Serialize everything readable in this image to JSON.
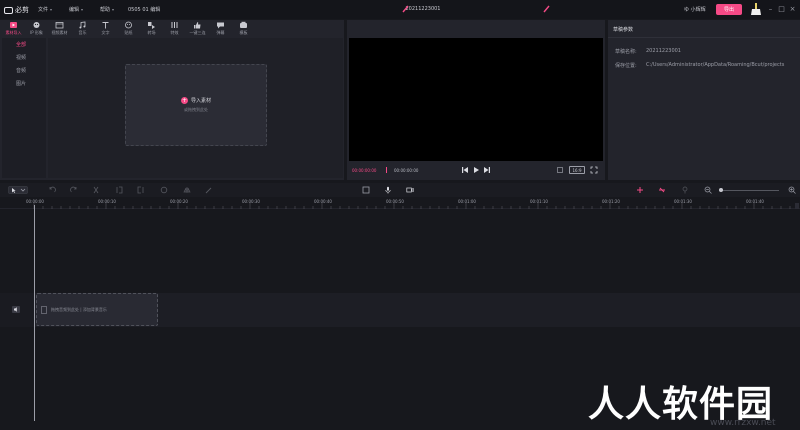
{
  "titlebar": {
    "app_name": "必剪",
    "menus": [
      "文件",
      "编辑",
      "帮助"
    ],
    "project_name": "0505 01 编辑",
    "center_title": "20211223001",
    "user_name": "ゆ 小辉辉",
    "export_label": "导出"
  },
  "tools": [
    {
      "label": "素材导入",
      "icon": "media-icon",
      "active": true
    },
    {
      "label": "IP 形象",
      "icon": "avatar-icon",
      "active": false
    },
    {
      "label": "视频素材",
      "icon": "video-icon",
      "active": false
    },
    {
      "label": "音乐",
      "icon": "music-icon",
      "active": false
    },
    {
      "label": "文字",
      "icon": "text-icon",
      "active": false
    },
    {
      "label": "贴纸",
      "icon": "sticker-icon",
      "active": false
    },
    {
      "label": "转场",
      "icon": "transition-icon",
      "active": false
    },
    {
      "label": "特效",
      "icon": "effect-icon",
      "active": false
    },
    {
      "label": "一键三连",
      "icon": "like-icon",
      "active": false
    },
    {
      "label": "弹幕",
      "icon": "danmaku-icon",
      "active": false
    },
    {
      "label": "模板",
      "icon": "template-icon",
      "active": false
    }
  ],
  "media_sidebar": [
    {
      "label": "全部",
      "active": true
    },
    {
      "label": "视频",
      "active": false
    },
    {
      "label": "音频",
      "active": false
    },
    {
      "label": "图片",
      "active": false
    }
  ],
  "import": {
    "label": "导入素材",
    "hint": "或拖拽到此处"
  },
  "preview": {
    "time_current": "00:00:00:00",
    "time_total": "00:00:00:00",
    "ratio": "16:9"
  },
  "properties": {
    "header": "草稿参数",
    "rows": [
      {
        "label": "草稿名称:",
        "value": "20211223001"
      },
      {
        "label": "保存位置:",
        "value": "C:/Users/Administrator/AppData/Roaming/Bcut/projects"
      }
    ]
  },
  "ruler": {
    "labels": [
      "00:00:00",
      "00:00:10",
      "00:00:20",
      "00:00:30",
      "00:00:40",
      "00:00:50",
      "00:01:00",
      "00:01:10",
      "00:01:20",
      "00:01:30",
      "00:01:40"
    ]
  },
  "audio_track": {
    "drop_text": "拖拽音频到此处 | 添加背景音乐"
  },
  "watermark": {
    "text": "人人软件园",
    "url": "www.rrzxw.net"
  },
  "colors": {
    "accent": "#f54a86",
    "panel": "#23242c",
    "background": "#17181d"
  }
}
